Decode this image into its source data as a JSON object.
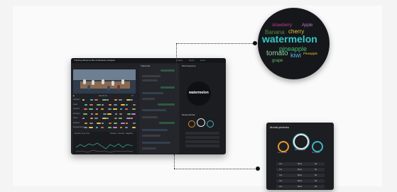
{
  "dashboard": {
    "title": "Tracking Observer Box & Behavior analysis",
    "tabs": [
      "Analysis",
      "Report",
      "Export"
    ],
    "video_controls": [
      "▶",
      "00:00:10",
      "⟲"
    ],
    "timeline_labels": [
      "Speaker",
      "Gaze",
      "Gesture",
      "Emotion",
      "Voice",
      "Posture",
      "Engagement"
    ],
    "graph_label": "Emotion over time",
    "graph_legend": "Positive · Neutral · Negative",
    "transcript_header": "Transcript",
    "insights_header": "Word frequency",
    "model_header_small": "Model particles",
    "mini_cloud_word": "watermelon"
  },
  "word_cloud": {
    "words": [
      {
        "text": "strawberry",
        "color": "#c0428a"
      },
      {
        "text": "Apple",
        "color": "#b07cc6"
      },
      {
        "text": "Banana",
        "color": "#4f8c3d"
      },
      {
        "text": "cherry",
        "color": "#e2c13b"
      },
      {
        "text": "watermelon",
        "color": "#35c9c5"
      },
      {
        "text": "pineapple",
        "color": "#3cc07a"
      },
      {
        "text": "tomato",
        "color": "#8fd4a0"
      },
      {
        "text": "kiwi",
        "color": "#54b5e0"
      },
      {
        "text": "Pineapple",
        "color": "#e2c13b"
      },
      {
        "text": "grape",
        "color": "#5fbf6a"
      }
    ]
  },
  "model_panel": {
    "title": "Modal particles",
    "gauges": [
      {
        "label": "Yes",
        "value_text": "10 times",
        "color": "#e89a2c"
      },
      {
        "label": "Mmm",
        "value_text": "22 times",
        "color": "#e8e8e8"
      },
      {
        "label": "No",
        "value_text": "6 times",
        "color": "#3fb4c9"
      }
    ],
    "rows": [
      [
        "Yes",
        "Mmm",
        "No"
      ],
      [
        "Yes",
        "Mmm",
        "No"
      ],
      [
        "Yes",
        "Mmm",
        "No"
      ],
      [
        "Yes",
        "Mmm",
        "No"
      ],
      [
        "Yes",
        "Mmm",
        "No"
      ]
    ]
  }
}
